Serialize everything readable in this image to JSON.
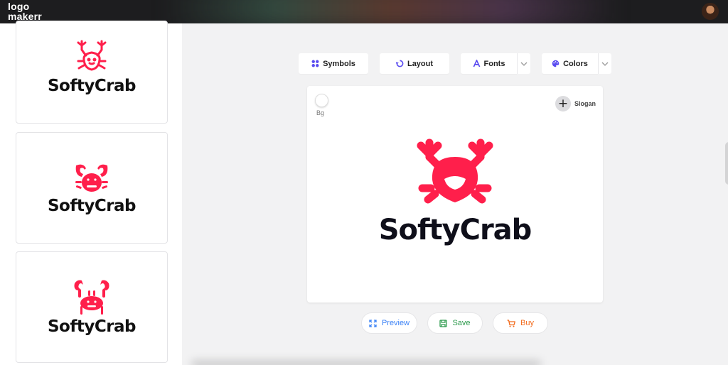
{
  "brand": {
    "line1": "logo",
    "line2": "makerr"
  },
  "toolbar": {
    "symbols": {
      "label": "Symbols",
      "icon": "symbols-icon"
    },
    "layout": {
      "label": "Layout",
      "icon": "layout-icon"
    },
    "fonts": {
      "label": "Fonts",
      "icon": "fonts-icon"
    },
    "colors": {
      "label": "Colors",
      "icon": "palette-icon"
    }
  },
  "canvas": {
    "bg_label": "Bg",
    "slogan_label": "Slogan",
    "logo_name": "SoftyCrab",
    "brand_color": "#ff1f4b"
  },
  "variants": [
    {
      "name": "SoftyCrab",
      "style": "outline-crab"
    },
    {
      "name": "SoftyCrab",
      "style": "round-crab"
    },
    {
      "name": "SoftyCrab",
      "style": "simple-crab"
    }
  ],
  "actions": {
    "preview": {
      "label": "Preview",
      "color": "#3b82f6"
    },
    "save": {
      "label": "Save",
      "color": "#2e9b4e"
    },
    "buy": {
      "label": "Buy",
      "color": "#f26a1b"
    }
  }
}
